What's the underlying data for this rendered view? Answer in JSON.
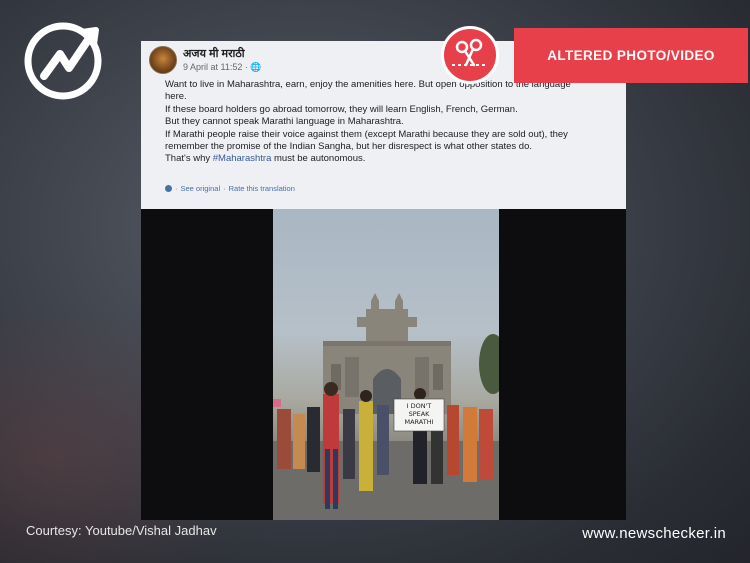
{
  "brand": {
    "site": "www.newschecker.in",
    "courtesy": "Courtesy: Youtube/Vishal Jadhav",
    "accent_color": "#e8404a"
  },
  "badge": {
    "label": "ALTERED PHOTO/VIDEO",
    "icon": "scissors-icon"
  },
  "post": {
    "author": "अजय मी मराठी",
    "date": "9 April at 11:52 · ",
    "privacy_icon": "globe-icon",
    "lines": [
      "Want to live in Maharashtra, earn, enjoy the amenities here. But open opposition to the language",
      "here.",
      "If these board holders go abroad tomorrow, they will learn English, French, German.",
      "But they cannot speak Marathi language in Maharashtra.",
      "If Marathi people raise their voice against them (except Marathi because they are sold out), they",
      "remember the promise of the Indian Sangha, but her disrespect is what other states do."
    ],
    "last_line_prefix": "That's why ",
    "hashtag": "#Maharashtra",
    "last_line_suffix": " must be autonomous.",
    "see_original": "See original",
    "separator": " · ",
    "rate_translation": "Rate this translation"
  },
  "video": {
    "placard_line1": "I DON'T",
    "placard_line2": "SPEAK",
    "placard_line3": "MARATHI"
  }
}
